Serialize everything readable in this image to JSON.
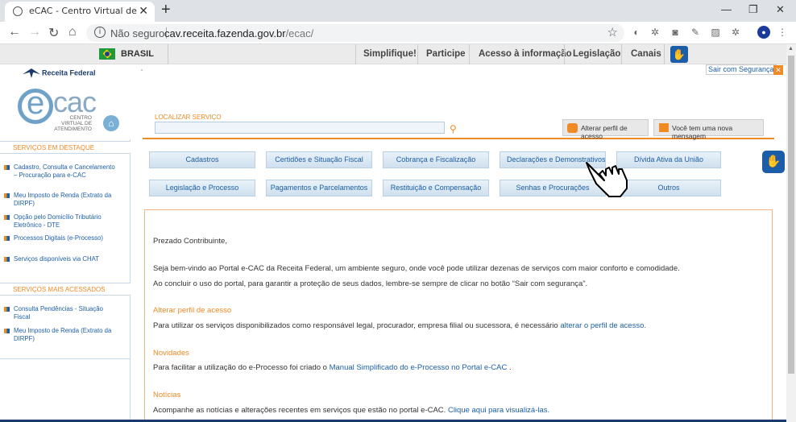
{
  "browser": {
    "tab_title": "eCAC - Centro Virtual de Atendimento",
    "new_tab": "+",
    "security": "Não seguro",
    "url_host": "cav.receita.fazenda.gov.br",
    "url_path": "/ecac/"
  },
  "govbar": {
    "country": "BRASIL",
    "links": [
      "Simplifique!",
      "Participe",
      "Acesso à informação",
      "Legislação",
      "Canais"
    ]
  },
  "header": {
    "org": "Receita Federal",
    "logo_sub": "CENTRO VIRTUAL DE ATENDIMENTO",
    "logout": "Sair com Segurança"
  },
  "search": {
    "label": "LOCALIZAR SERVIÇO",
    "perfil_button": "Alterar perfil de acesso",
    "message_button": "Você tem uma nova mensagem"
  },
  "sidebar": {
    "section1_title": "SERVIÇOS EM DESTAQUE",
    "section1_items": [
      "Cadastro, Consulta e Cancelamento – Procuração para e-CAC",
      "Meu Imposto de Renda (Extrato da DIRPF)",
      "Opção pelo Domicílio Tributário Eletrônico - DTE",
      "Processos Digitais (e-Processo)",
      "Serviços disponíveis via CHAT"
    ],
    "section2_title": "SERVIÇOS MAIS ACESSADOS",
    "section2_items": [
      "Consulta Pendências - Situação Fiscal",
      "Meu Imposto de Renda (Extrato da DIRPF)"
    ]
  },
  "services": {
    "row1": [
      "Cadastros",
      "Certidões e Situação Fiscal",
      "Cobrança e Fiscalização",
      "Declarações e Demonstrativos",
      "Dívida Ativa da União"
    ],
    "row2": [
      "Legislação e Processo",
      "Pagamentos e Parcelamentos",
      "Restituição e Compensação",
      "Senhas e Procurações",
      "Outros"
    ]
  },
  "content": {
    "greeting": "Prezado Contribuinte,",
    "welcome": "Seja bem-vindo ao Portal e-CAC da Receita Federal, um ambiente seguro, onde você pode utilizar dezenas de serviços com maior conforto e comodidade.",
    "logout_tip": "Ao concluir o uso do portal, para garantir a proteção de seus dados, lembre-se sempre de clicar no botão “Sair com segurança”.",
    "perfil_title": "Alterar perfil de acesso",
    "perfil_text": "Para utilizar os serviços disponibilizados como responsável legal, procurador, empresa filial ou sucessora, é necessário",
    "perfil_link": "alterar o perfil de acesso.",
    "novidades_title": "Novidades",
    "novidades_text": "Para facilitar a utilização do e-Processo foi criado o",
    "novidades_link": "Manual Simplificado do e-Processo no Portal e-CAC",
    "novidades_end": ".",
    "noticias_title": "Notícias",
    "noticias_text": "Acompanhe as notícias e alterações recentes em serviços que estão no portal e-CAC.",
    "noticias_link": "Clique aqui para visualizá-las."
  }
}
